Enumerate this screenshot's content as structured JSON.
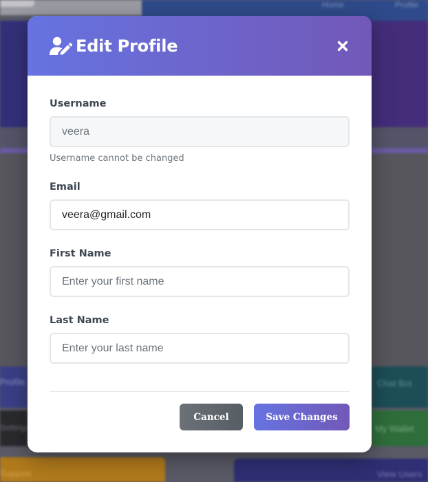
{
  "background": {
    "nav_links": [
      "Home",
      "Profile"
    ],
    "cards": [
      "Profile",
      "Chat Bot",
      "Settings",
      "My Wallet",
      "Support",
      "View Users"
    ]
  },
  "modal": {
    "title": "Edit Profile",
    "header_icon": "user-edit-icon",
    "close_icon": "close-icon",
    "colors": {
      "header_gradient_start": "#6673e0",
      "header_gradient_end": "#7258b8",
      "cancel_button": "#62676e",
      "save_button_start": "#6673e0",
      "save_button_end": "#7258b8"
    },
    "fields": {
      "username": {
        "label": "Username",
        "value": "veera",
        "placeholder": "",
        "help": "Username cannot be changed"
      },
      "email": {
        "label": "Email",
        "value": "veera@gmail.com",
        "placeholder": ""
      },
      "first_name": {
        "label": "First Name",
        "value": "",
        "placeholder": "Enter your first name"
      },
      "last_name": {
        "label": "Last Name",
        "value": "",
        "placeholder": "Enter your last name"
      }
    },
    "buttons": {
      "cancel": "Cancel",
      "save": "Save Changes"
    }
  }
}
